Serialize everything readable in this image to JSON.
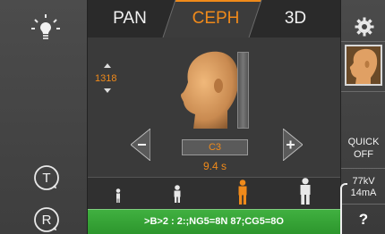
{
  "tabs": [
    {
      "label": "PAN",
      "active": false
    },
    {
      "label": "CEPH",
      "active": true
    },
    {
      "label": "3D",
      "active": false
    }
  ],
  "height_value": "1318",
  "vertebra": "C3",
  "exposure_time": "9.4 s",
  "quick_off": {
    "line1": "QUICK",
    "line2": "OFF"
  },
  "exposure": {
    "kv": "77kV",
    "ma": "14mA"
  },
  "help_label": "?",
  "status_message": ">B>2 : 2:;NG5=8N 87;CG5=8O",
  "left_buttons": {
    "t_label": "T",
    "r_label": "R"
  },
  "icons": [
    "lamp-icon",
    "gear-icon",
    "patient-head-icon",
    "minus-arrow-icon",
    "plus-arrow-icon",
    "t-timer-icon",
    "r-reset-icon"
  ],
  "patient_sizes": [
    "child-small",
    "child",
    "adult-medium",
    "adult-large"
  ],
  "selected_patient_size": "adult-medium",
  "colors": {
    "accent": "#f08a1a",
    "status_ok": "#37a537",
    "background": "#2b2b2b"
  }
}
